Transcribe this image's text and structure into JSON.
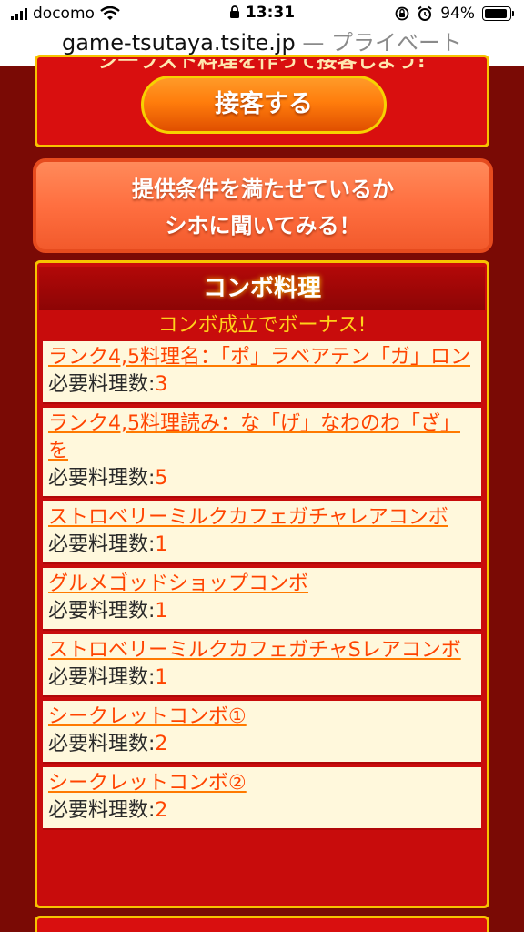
{
  "status": {
    "carrier": "docomo",
    "time": "13:31",
    "battery": "94%",
    "battery_level": 0.94
  },
  "url": {
    "host": "game-tsutaya.tsite.jp",
    "sep": " — ",
    "mode": "プライベート"
  },
  "top_panel": {
    "cut_text": "ジ一ラスト料理を作って接客しよう!",
    "serve_button": "接客する"
  },
  "ask_button": {
    "line1": "提供条件を満たせているか",
    "line2": "シホに聞いてみる！"
  },
  "combo": {
    "title": "コンボ料理",
    "subtitle": "コンボ成立でボーナス!",
    "need_label": "必要料理数:",
    "items": [
      {
        "name": "ランク4,5料理名：「ポ」ラベアテン「ガ」ロン",
        "count": "3"
      },
      {
        "name": "ランク4,5料理読み：な「げ」なわのわ「ざ」を",
        "count": "5"
      },
      {
        "name": "ストロベリーミルクカフェガチャレアコンボ",
        "count": "1"
      },
      {
        "name": "グルメゴッドショップコンボ",
        "count": "1"
      },
      {
        "name": "ストロベリーミルクカフェガチャSレアコンボ",
        "count": "1"
      },
      {
        "name": "シークレットコンボ①",
        "count": "2"
      },
      {
        "name": "シークレットコンボ②",
        "count": "2"
      }
    ]
  }
}
